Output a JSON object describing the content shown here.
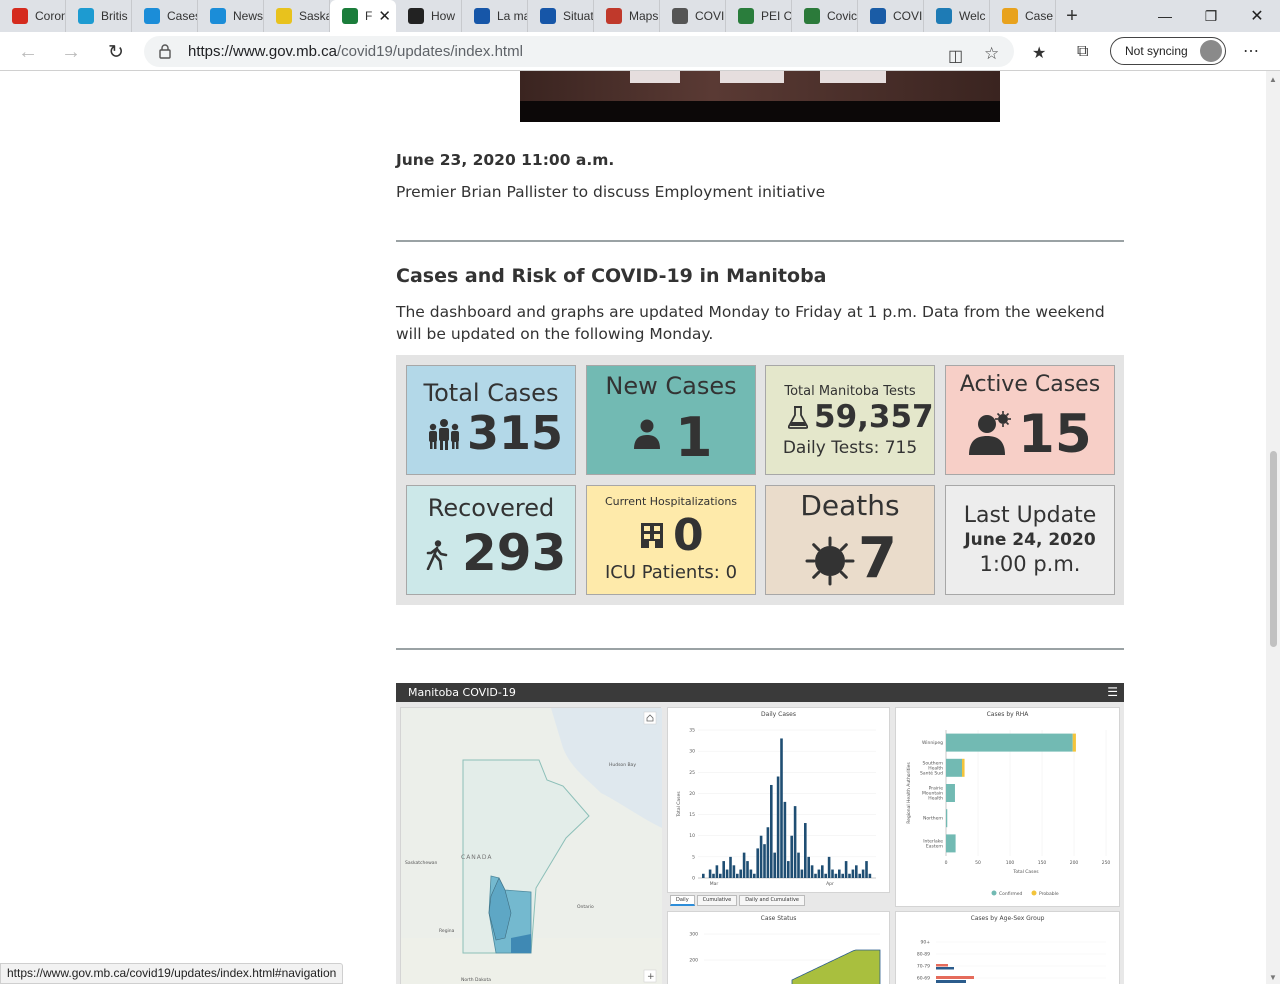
{
  "browser": {
    "tabs": [
      {
        "title": "Coron",
        "icon": "canada-flag-icon",
        "color": "#d52b1e"
      },
      {
        "title": "Britis",
        "icon": "bc-icon",
        "color": "#1d9bd1"
      },
      {
        "title": "Cases",
        "icon": "alberta-icon",
        "color": "#1b8dd8"
      },
      {
        "title": "News",
        "icon": "alberta-icon",
        "color": "#1b8dd8"
      },
      {
        "title": "Saska",
        "icon": "saskatchewan-icon",
        "color": "#e8c21d"
      },
      {
        "title": "F",
        "icon": "manitoba-icon",
        "color": "#1b7d3b",
        "active": true
      },
      {
        "title": "How",
        "icon": "shield-icon",
        "color": "#222222"
      },
      {
        "title": "La ma",
        "icon": "quebec-icon",
        "color": "#1656a8"
      },
      {
        "title": "Situat",
        "icon": "quebec-icon",
        "color": "#1656a8"
      },
      {
        "title": "Maps",
        "icon": "maps-icon",
        "color": "#c0392b"
      },
      {
        "title": "COVI",
        "icon": "gov-icon",
        "color": "#555555"
      },
      {
        "title": "PEI C",
        "icon": "pei-icon",
        "color": "#2a7d3c"
      },
      {
        "title": "Covic",
        "icon": "globe-icon",
        "color": "#2b7a3a"
      },
      {
        "title": "COVI",
        "icon": "nl-icon",
        "color": "#1a5ca6"
      },
      {
        "title": "Welc",
        "icon": "yukon-icon",
        "color": "#1e7bb5"
      },
      {
        "title": "Case",
        "icon": "nwt-icon",
        "color": "#e8a21d"
      }
    ],
    "url_host": "https://www.gov.mb.ca",
    "url_path": "/covid19/updates/index.html",
    "sync_label": "Not syncing",
    "status_url": "https://www.gov.mb.ca/covid19/updates/index.html#navigation"
  },
  "page": {
    "announcement_date": "June 23, 2020 11:00 a.m.",
    "announcement_text": "Premier Brian Pallister to discuss Employment initiative",
    "section_title": "Cases and Risk of COVID-19 in Manitoba",
    "section_text": "The dashboard and graphs are updated Monday to Friday at 1 p.m. Data from the weekend will be updated on the following Monday."
  },
  "cards": {
    "total": {
      "label": "Total Cases",
      "value": "315",
      "icon": "people-group-icon"
    },
    "new": {
      "label": "New Cases",
      "value": "1",
      "icon": "person-icon"
    },
    "tests": {
      "label": "Total Manitoba Tests",
      "value": "59,357",
      "sub": "Daily Tests: 715",
      "icon": "flask-icon"
    },
    "active": {
      "label": "Active Cases",
      "value": "15",
      "icon": "person-virus-icon"
    },
    "recovered": {
      "label": "Recovered",
      "value": "293",
      "icon": "walking-person-icon"
    },
    "hosp": {
      "label": "Current Hospitalizations",
      "value": "0",
      "sub": "ICU Patients: 0",
      "icon": "hospital-building-icon"
    },
    "deaths": {
      "label": "Deaths",
      "value": "7",
      "icon": "virus-icon"
    },
    "last_update": {
      "label": "Last Update",
      "date": "June 24, 2020",
      "time": "1:00 p.m."
    }
  },
  "embed": {
    "title": "Manitoba COVID-19",
    "map_labels": {
      "hudson": "Hudson Bay",
      "canada": "CANADA",
      "sask": "Saskatchewan",
      "ont": "Ontario",
      "regina": "Regina",
      "nd": "North Dakota"
    },
    "daily_cases": {
      "title": "Daily Cases",
      "ylabel": "Total Cases",
      "yticks": [
        "0",
        "5",
        "10",
        "15",
        "20",
        "25",
        "30",
        "35"
      ],
      "xticks": [
        "Mar",
        "Apr"
      ],
      "tabs": [
        "Daily",
        "Cumulative",
        "Daily and Cumulative"
      ]
    },
    "rha": {
      "title": "Cases by RHA",
      "ylabel": "Regional Health Authorities",
      "xlabel": "Total Cases",
      "xticks": [
        "0",
        "50",
        "100",
        "150",
        "200",
        "250"
      ],
      "legend": [
        "Confirmed",
        "Probable"
      ]
    },
    "case_status": {
      "title": "Case Status",
      "yticks": [
        "300",
        "200",
        "100"
      ]
    },
    "age_sex": {
      "title": "Cases by Age-Sex Group",
      "yticks": [
        "90+",
        "80-89",
        "70-79",
        "60-69"
      ]
    },
    "chart_data": [
      {
        "type": "bar",
        "title": "Daily Cases",
        "ylabel": "Total Cases",
        "ylim": [
          0,
          35
        ],
        "xlabel": "",
        "values": [
          1,
          0,
          2,
          1,
          3,
          1,
          4,
          2,
          5,
          3,
          1,
          2,
          6,
          4,
          2,
          1,
          7,
          10,
          8,
          12,
          22,
          6,
          24,
          33,
          18,
          4,
          10,
          17,
          6,
          2,
          13,
          5,
          3,
          1,
          2,
          3,
          1,
          5,
          2,
          1,
          2,
          1,
          4,
          1,
          2,
          3,
          1,
          2,
          4,
          1
        ]
      },
      {
        "type": "bar",
        "title": "Cases by RHA",
        "xlabel": "Total Cases",
        "ylabel": "Regional Health Authorities",
        "xlim": [
          0,
          250
        ],
        "categories": [
          "Winnipeg",
          "Southern Health-Santé Sud",
          "Prairie Mountain Health",
          "Northern",
          "Interlake-Eastern"
        ],
        "series": [
          {
            "name": "Confirmed",
            "values": [
              198,
              25,
              14,
              2,
              15
            ],
            "color": "#72bab3"
          },
          {
            "name": "Probable",
            "values": [
              5,
              4,
              0,
              0,
              0
            ],
            "color": "#f3c43b"
          }
        ]
      }
    ]
  },
  "colors": {
    "rule": "#9aa2a4",
    "bar_dark": "#1f4e73",
    "bar_teal": "#72bab3",
    "bar_yellow": "#f3c43b",
    "status_green": "#a9bf3e",
    "age_red": "#e56b5b",
    "age_blue": "#2b5c8c"
  }
}
